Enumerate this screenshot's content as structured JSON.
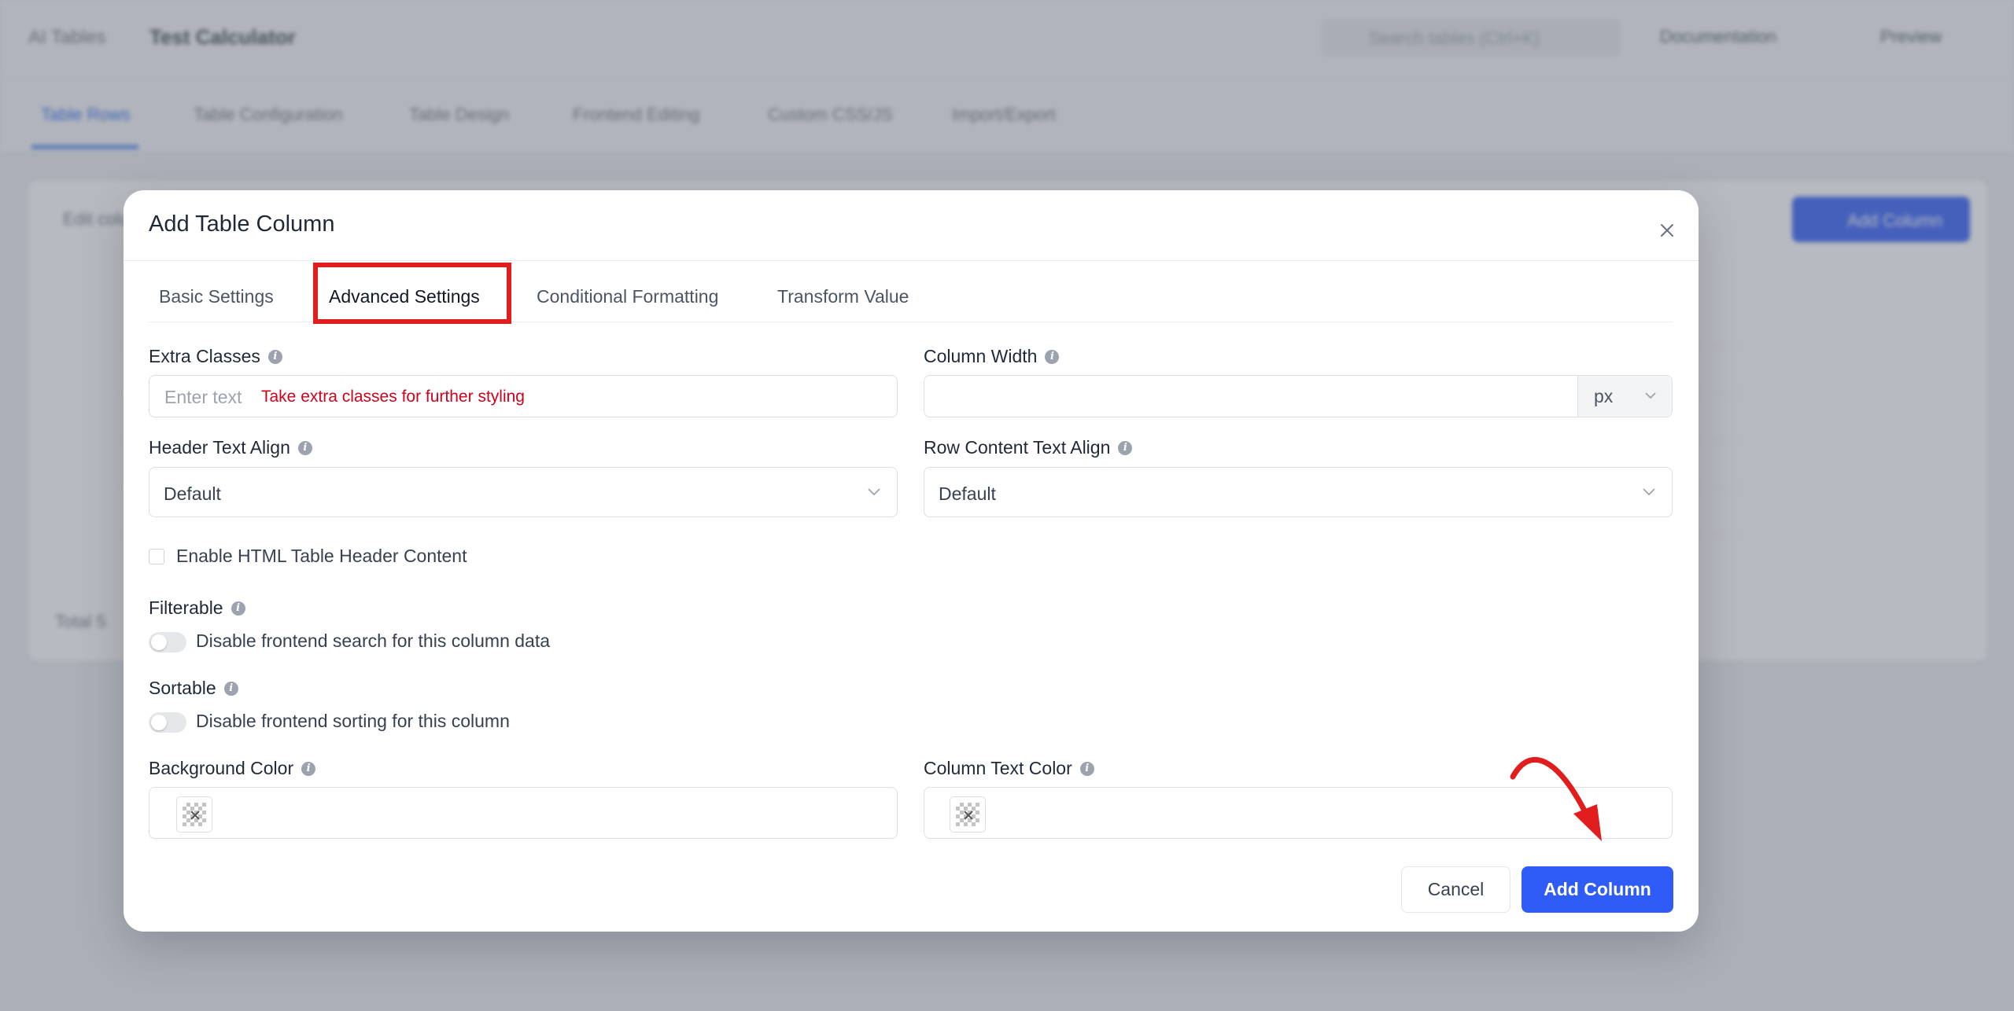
{
  "background": {
    "brand": "AI Tables",
    "title": "Test Calculator",
    "search_placeholder": "Search tables (Ctrl+K)",
    "documentation_label": "Documentation",
    "preview_label": "Preview",
    "tabs": [
      "Table Rows",
      "Table Configuration",
      "Table Design",
      "Frontend Editing",
      "Custom CSS/JS",
      "Import/Export"
    ],
    "card_heading": "Edit columns",
    "add_button": "Add Column",
    "total_label": "Total 5"
  },
  "modal": {
    "title": "Add Table Column",
    "tabs": [
      "Basic Settings",
      "Advanced Settings",
      "Conditional Formatting",
      "Transform Value"
    ],
    "active_tab": "Advanced Settings",
    "extra_classes": {
      "label": "Extra Classes",
      "placeholder": "Enter text",
      "hint": "Take extra classes for further styling"
    },
    "column_width": {
      "label": "Column Width",
      "value": "",
      "unit": "px"
    },
    "header_text_align": {
      "label": "Header Text Align",
      "value": "Default"
    },
    "row_content_text_align": {
      "label": "Row Content Text Align",
      "value": "Default"
    },
    "enable_html_header": {
      "label": "Enable HTML Table Header Content",
      "checked": false
    },
    "filterable": {
      "label": "Filterable",
      "toggle_text": "Disable frontend search for this column data",
      "enabled": false
    },
    "sortable": {
      "label": "Sortable",
      "toggle_text": "Disable frontend sorting for this column",
      "enabled": false
    },
    "background_color": {
      "label": "Background Color"
    },
    "column_text_color": {
      "label": "Column Text Color"
    },
    "buttons": {
      "cancel": "Cancel",
      "add": "Add Column"
    }
  },
  "colors": {
    "primary": "#2f5cf6",
    "annotation": "#e11d1d",
    "hint": "#d0021b"
  }
}
